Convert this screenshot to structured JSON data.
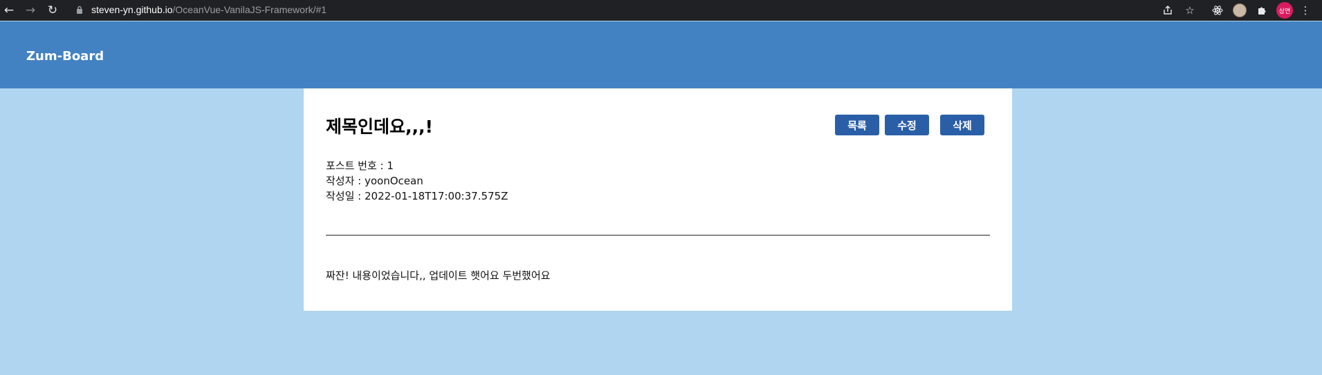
{
  "browser": {
    "url_host": "steven-yn.github.io",
    "url_path": "/OceanVue-VanilaJS-Framework/#1",
    "profile_initials": "상연",
    "icons": {
      "back": "back-arrow-icon",
      "forward": "forward-arrow-icon",
      "reload": "reload-icon",
      "lock": "lock-icon",
      "share": "share-icon",
      "bookmark": "star-icon",
      "react_devtools": "atom-icon",
      "extensions": "puzzle-icon",
      "menu": "kebab-menu-icon"
    }
  },
  "header": {
    "brand": "Zum-Board"
  },
  "post": {
    "title": "제목인데요,,,!",
    "buttons": {
      "list": "목록",
      "edit": "수정",
      "delete": "삭제"
    },
    "meta": {
      "number": "포스트 번호 : 1",
      "author": "작성자 : yoonOcean",
      "date": "작성일 : 2022-01-18T17:00:37.575Z"
    },
    "content": "짜잔! 내용이었습니다,, 업데이트 햇어요 두번했어요"
  },
  "colors": {
    "page_bg": "#afd5f0",
    "header_bg": "#4282c2",
    "button_bg": "#2a5fa8",
    "card_bg": "#ffffff",
    "chrome_bg": "#202124",
    "avatar_bg": "#d81b60"
  }
}
